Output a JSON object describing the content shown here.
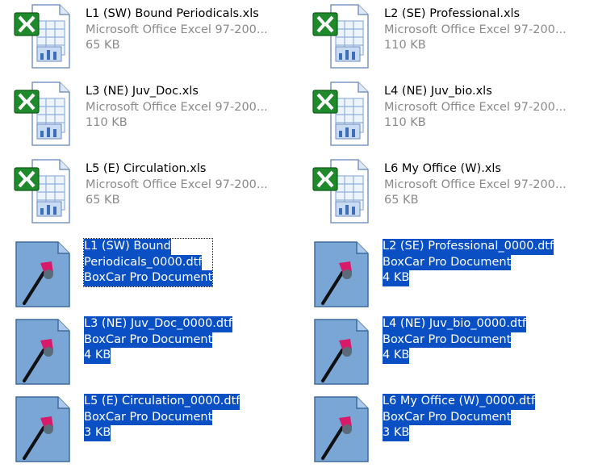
{
  "files": [
    {
      "type": "xls",
      "name": "L1 (SW)  Bound Periodicals.xls",
      "desc": "Microsoft Office Excel 97-200...",
      "size": "65 KB",
      "icon": "excel-file-icon"
    },
    {
      "type": "xls",
      "name": "L2 (SE) Professional.xls",
      "desc": "Microsoft Office Excel 97-200...",
      "size": "110 KB",
      "icon": "excel-file-icon"
    },
    {
      "type": "xls",
      "name": "L3 (NE) Juv_Doc.xls",
      "desc": "Microsoft Office Excel 97-200...",
      "size": "110 KB",
      "icon": "excel-file-icon"
    },
    {
      "type": "xls",
      "name": "L4 (NE) Juv_bio.xls",
      "desc": "Microsoft Office Excel 97-200...",
      "size": "110 KB",
      "icon": "excel-file-icon"
    },
    {
      "type": "xls",
      "name": "L5 (E) Circulation.xls",
      "desc": "Microsoft Office Excel 97-200...",
      "size": "65 KB",
      "icon": "excel-file-icon"
    },
    {
      "type": "xls",
      "name": "L6 My Office (W).xls",
      "desc": "Microsoft Office Excel 97-200...",
      "size": "65 KB",
      "icon": "excel-file-icon"
    },
    {
      "type": "dtf",
      "name_line1": "L1 (SW)  Bound",
      "name_line2": "Periodicals_0000.dtf",
      "desc": "BoxCar Pro Document",
      "icon": "boxcar-document-icon"
    },
    {
      "type": "dtf",
      "name": "L2 (SE) Professional_0000.dtf",
      "desc": "BoxCar Pro Document",
      "size": "4 KB",
      "icon": "boxcar-document-icon"
    },
    {
      "type": "dtf",
      "name": "L3 (NE) Juv_Doc_0000.dtf",
      "desc": "BoxCar Pro Document",
      "size": "4 KB",
      "icon": "boxcar-document-icon"
    },
    {
      "type": "dtf",
      "name": "L4 (NE) Juv_bio_0000.dtf",
      "desc": "BoxCar Pro Document",
      "size": "4 KB",
      "icon": "boxcar-document-icon"
    },
    {
      "type": "dtf",
      "name": "L5 (E) Circulation_0000.dtf",
      "desc": "BoxCar Pro Document",
      "size": "3 KB",
      "icon": "boxcar-document-icon"
    },
    {
      "type": "dtf",
      "name": "L6 My Office (W)_0000.dtf",
      "desc": "BoxCar Pro Document",
      "size": "3 KB",
      "icon": "boxcar-document-icon"
    }
  ],
  "colors": {
    "selection": "#0a50c4",
    "excel_green": "#1f8a2c",
    "doc_blue": "#7aa6d6"
  }
}
